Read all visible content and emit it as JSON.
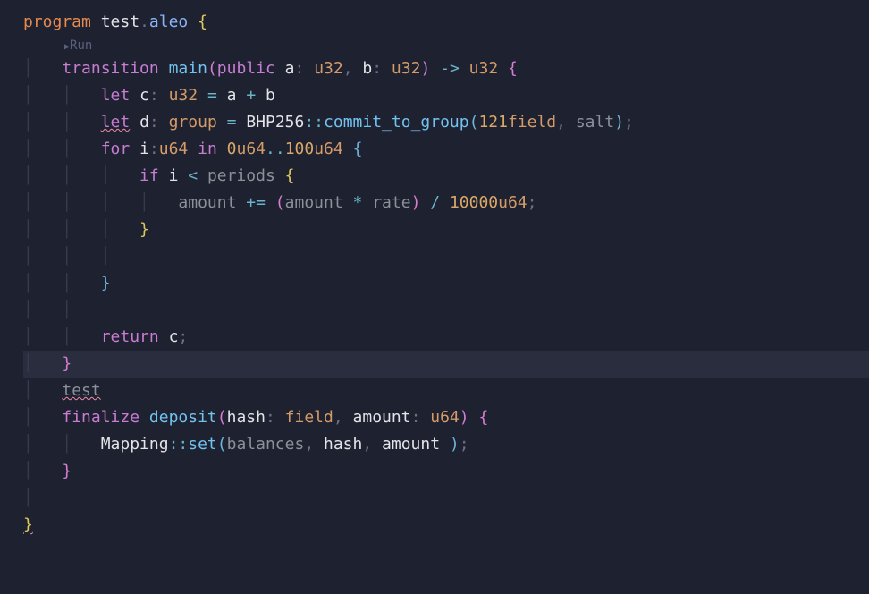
{
  "run_hint": "Run",
  "line1": {
    "program": "program",
    "name": "test",
    "dot": ".",
    "ext": "aleo",
    "brace": "{"
  },
  "line3": {
    "transition": "transition",
    "func": "main",
    "public": "public",
    "a": "a",
    "u32a": "u32",
    "b": "b",
    "u32b": "u32",
    "arrow": "->",
    "u32r": "u32",
    "brace": "{"
  },
  "line4": {
    "let": "let",
    "c": "c",
    "type": "u32",
    "eq": "=",
    "a": "a",
    "plus": "+",
    "b": "b"
  },
  "line5": {
    "let": "let",
    "d": "d",
    "type": "group",
    "eq": "=",
    "bhp": "BHP256",
    "sep": "::",
    "func": "commit_to_group",
    "num": "121",
    "field": "field",
    "salt": "salt"
  },
  "line6": {
    "for": "for",
    "i": "i",
    "u64": "u64",
    "in": "in",
    "zero": "0",
    "u64a": "u64",
    "dots": "..",
    "hundred": "100",
    "u64b": "u64",
    "brace": "{"
  },
  "line7": {
    "if": "if",
    "i": "i",
    "lt": "<",
    "periods": "periods",
    "brace": "{"
  },
  "line8": {
    "amount": "amount",
    "peq": "+=",
    "amount2": "amount",
    "mul": "*",
    "rate": "rate",
    "div": "/",
    "num": "10000",
    "u64": "u64"
  },
  "line9": {
    "brace": "}"
  },
  "line11": {
    "brace": "}"
  },
  "line13": {
    "return": "return",
    "c": "c"
  },
  "line14": {
    "brace": "}"
  },
  "line15": {
    "test": "test"
  },
  "line16": {
    "finalize": "finalize",
    "deposit": "deposit",
    "hash": "hash",
    "field": "field",
    "amount": "amount",
    "u64": "u64",
    "brace": "{"
  },
  "line17": {
    "mapping": "Mapping",
    "sep": "::",
    "set": "set",
    "balances": "balances",
    "hash": "hash",
    "amount": "amount"
  },
  "line18": {
    "brace": "}"
  },
  "line20": {
    "brace": "}"
  }
}
